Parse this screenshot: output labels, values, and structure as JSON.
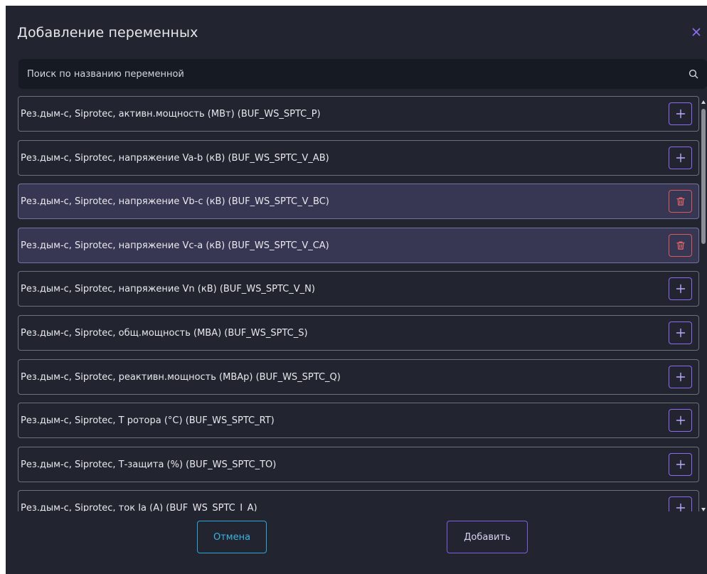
{
  "dialog": {
    "title": "Добавление переменных"
  },
  "search": {
    "placeholder": "Поиск по названию переменной",
    "value": ""
  },
  "colors": {
    "background": "#22252f",
    "selected_row": "#373753",
    "accent_purple": "#8b6cf0",
    "danger_red": "#d85a5a",
    "cancel_blue": "#2aa7d6"
  },
  "variables": [
    {
      "label": "Рез.дым-с, Siprotec, активн.мощность (МВт) (BUF_WS_SPTC_P)",
      "selected": false,
      "action_icon": "plus-icon"
    },
    {
      "label": "Рез.дым-с, Siprotec, напряжение Va-b (кВ) (BUF_WS_SPTC_V_AB)",
      "selected": false,
      "action_icon": "plus-icon"
    },
    {
      "label": "Рез.дым-с, Siprotec, напряжение Vb-c (кВ) (BUF_WS_SPTC_V_BC)",
      "selected": true,
      "action_icon": "trash-icon"
    },
    {
      "label": "Рез.дым-с, Siprotec, напряжение Vc-a (кВ) (BUF_WS_SPTC_V_CA)",
      "selected": true,
      "action_icon": "trash-icon"
    },
    {
      "label": "Рез.дым-с, Siprotec, напряжение Vn (кВ) (BUF_WS_SPTC_V_N)",
      "selected": false,
      "action_icon": "plus-icon"
    },
    {
      "label": "Рез.дым-с, Siprotec, общ.мощность (МВА) (BUF_WS_SPTC_S)",
      "selected": false,
      "action_icon": "plus-icon"
    },
    {
      "label": "Рез.дым-с, Siprotec, реактивн.мощность (МВАр) (BUF_WS_SPTC_Q)",
      "selected": false,
      "action_icon": "plus-icon"
    },
    {
      "label": "Рез.дым-с, Siprotec, Т ротора (°С) (BUF_WS_SPTC_RT)",
      "selected": false,
      "action_icon": "plus-icon"
    },
    {
      "label": "Рез.дым-с, Siprotec, Т-защита (%) (BUF_WS_SPTC_TO)",
      "selected": false,
      "action_icon": "plus-icon"
    },
    {
      "label": "Рез.дым-с, Siprotec, ток Ia (А) (BUF_WS_SPTC_I_A)",
      "selected": false,
      "action_icon": "plus-icon"
    }
  ],
  "footer": {
    "cancel_label": "Отмена",
    "confirm_label": "Добавить"
  }
}
